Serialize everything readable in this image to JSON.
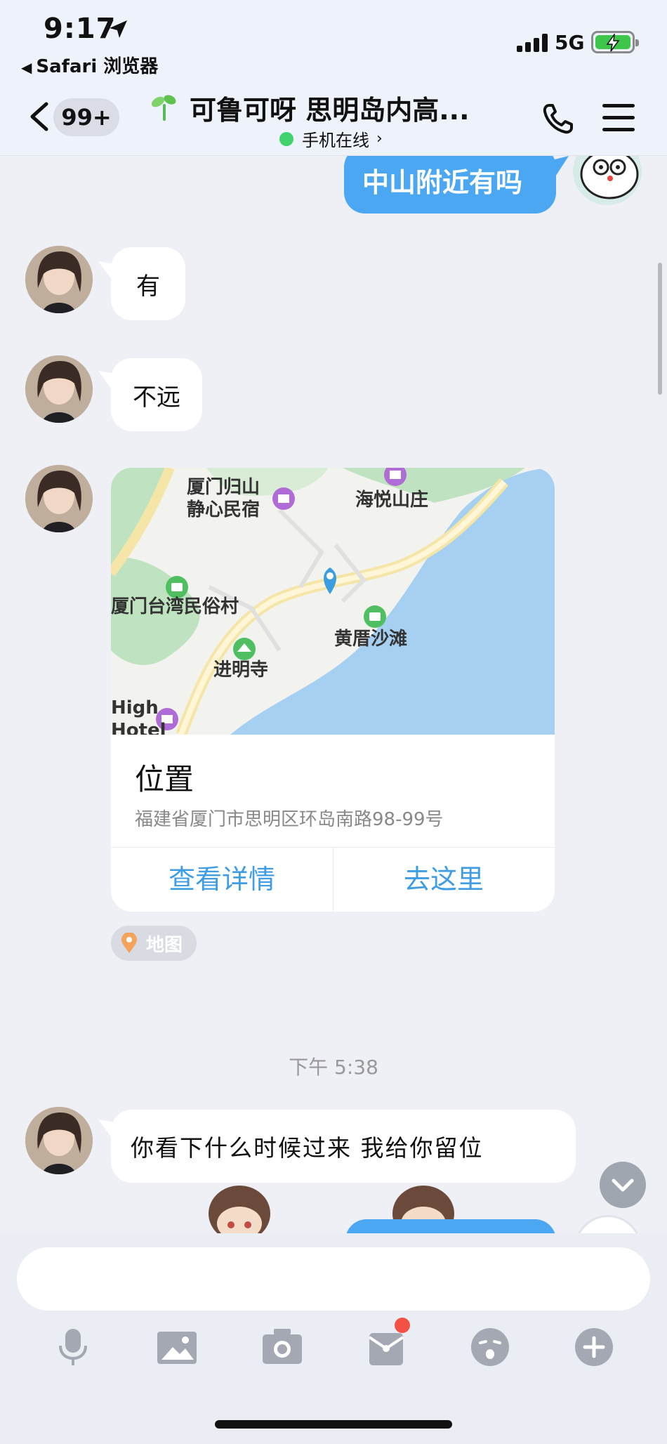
{
  "status_bar": {
    "time": "9:17",
    "back_app": "Safari 浏览器",
    "network": "5G"
  },
  "nav": {
    "badge": "99+",
    "title": "可鲁可呀 思明岛内高...",
    "online_status": "手机在线"
  },
  "messages": [
    {
      "direction": "out",
      "text": "中山附近有吗"
    },
    {
      "direction": "in",
      "text": "有"
    },
    {
      "direction": "in",
      "text": "不远"
    }
  ],
  "location_card": {
    "map_labels": [
      "厦门归山",
      "静心民宿",
      "海悦山庄",
      "厦门台湾民俗村",
      "黄厝沙滩",
      "进明寺",
      "High",
      "Hotel"
    ],
    "title": "位置",
    "address": "福建省厦门市思明区环岛南路98-99号",
    "view_details": "查看详情",
    "go_here": "去这里",
    "tag": "地图"
  },
  "timestamp": "下午 5:38",
  "last_message": "你看下什么时候过来  我给你留位",
  "input": {
    "placeholder": ""
  },
  "toolbar": [
    "microphone-icon",
    "image-icon",
    "camera-icon",
    "red-packet-icon",
    "emoji-icon",
    "plus-icon"
  ],
  "colors": {
    "accent": "#4ba7f2",
    "online": "#41d26e",
    "badge_dot": "#f25143"
  }
}
